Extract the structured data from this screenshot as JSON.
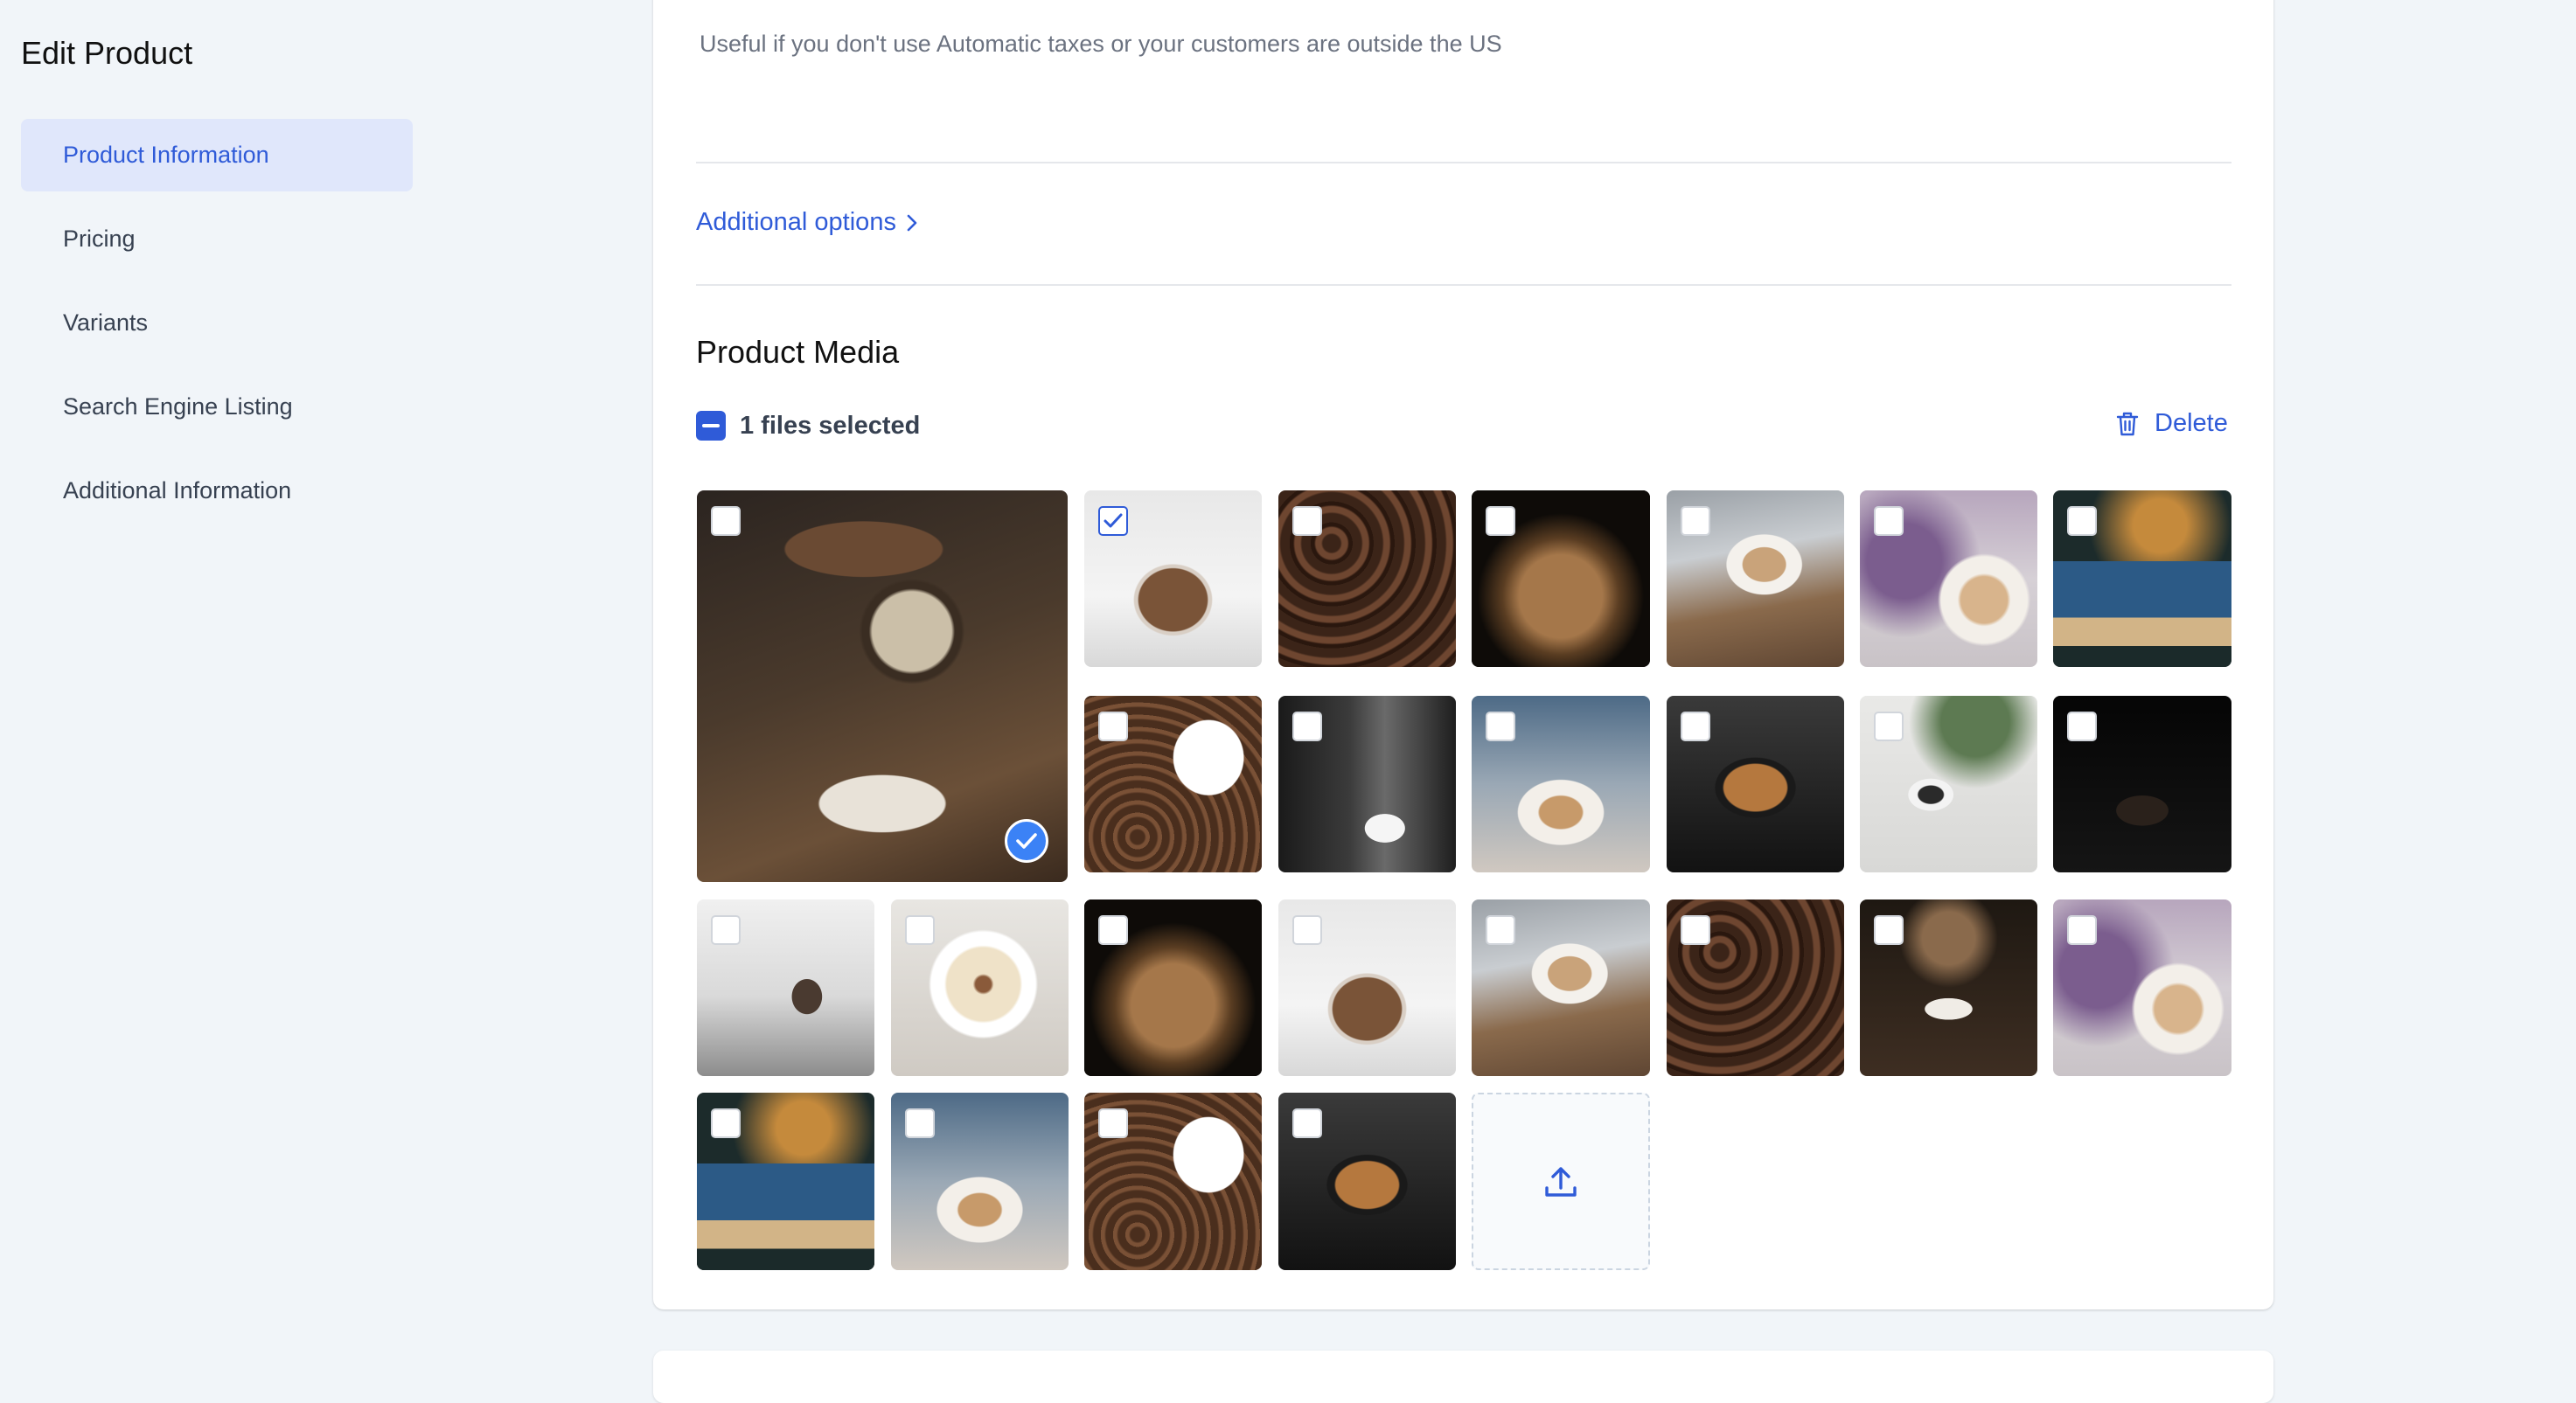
{
  "sidebar": {
    "title": "Edit Product",
    "items": [
      {
        "label": "Product Information",
        "active": true
      },
      {
        "label": "Pricing"
      },
      {
        "label": "Variants"
      },
      {
        "label": "Search Engine Listing"
      },
      {
        "label": "Additional Information"
      }
    ]
  },
  "main": {
    "help_text": "Useful if you don't use Automatic taxes or your customers are outside the US",
    "additional_options_label": "Additional options",
    "media": {
      "title": "Product Media",
      "selection_text": "1 files selected",
      "delete_label": "Delete",
      "tiles": [
        {
          "image": "coffee-still-life-scale",
          "selected": true,
          "featured": true,
          "checkbox_checked": false
        },
        {
          "image": "coffee-pour-glass",
          "checkbox_checked": true
        },
        {
          "image": "coffee-beans"
        },
        {
          "image": "beans-grinder"
        },
        {
          "image": "latte-laptop"
        },
        {
          "image": "latte-lavender"
        },
        {
          "image": "pour-over-blue-cup"
        },
        {
          "image": "spilled-cup-beans"
        },
        {
          "image": "espresso-machine"
        },
        {
          "image": "latte-art-pour"
        },
        {
          "image": "latte-art-dark"
        },
        {
          "image": "cup-plant-desk"
        },
        {
          "image": "black-cup-dark"
        },
        {
          "image": "coffee-book-desk"
        },
        {
          "image": "cappuccino-heart"
        },
        {
          "image": "beans-grinder"
        },
        {
          "image": "coffee-pour-glass"
        },
        {
          "image": "latte-laptop"
        },
        {
          "image": "coffee-beans"
        },
        {
          "image": "coffee-still-life-scale"
        },
        {
          "image": "latte-lavender"
        },
        {
          "image": "pour-over-blue-cup"
        },
        {
          "image": "latte-art-pour"
        },
        {
          "image": "spilled-cup-beans"
        },
        {
          "image": "latte-art-dark"
        }
      ],
      "upload_icon": "upload-icon"
    }
  },
  "colors": {
    "accent": "#2f5bd8",
    "active_bg": "#e0e7fb",
    "page_bg": "#f1f5f9"
  }
}
